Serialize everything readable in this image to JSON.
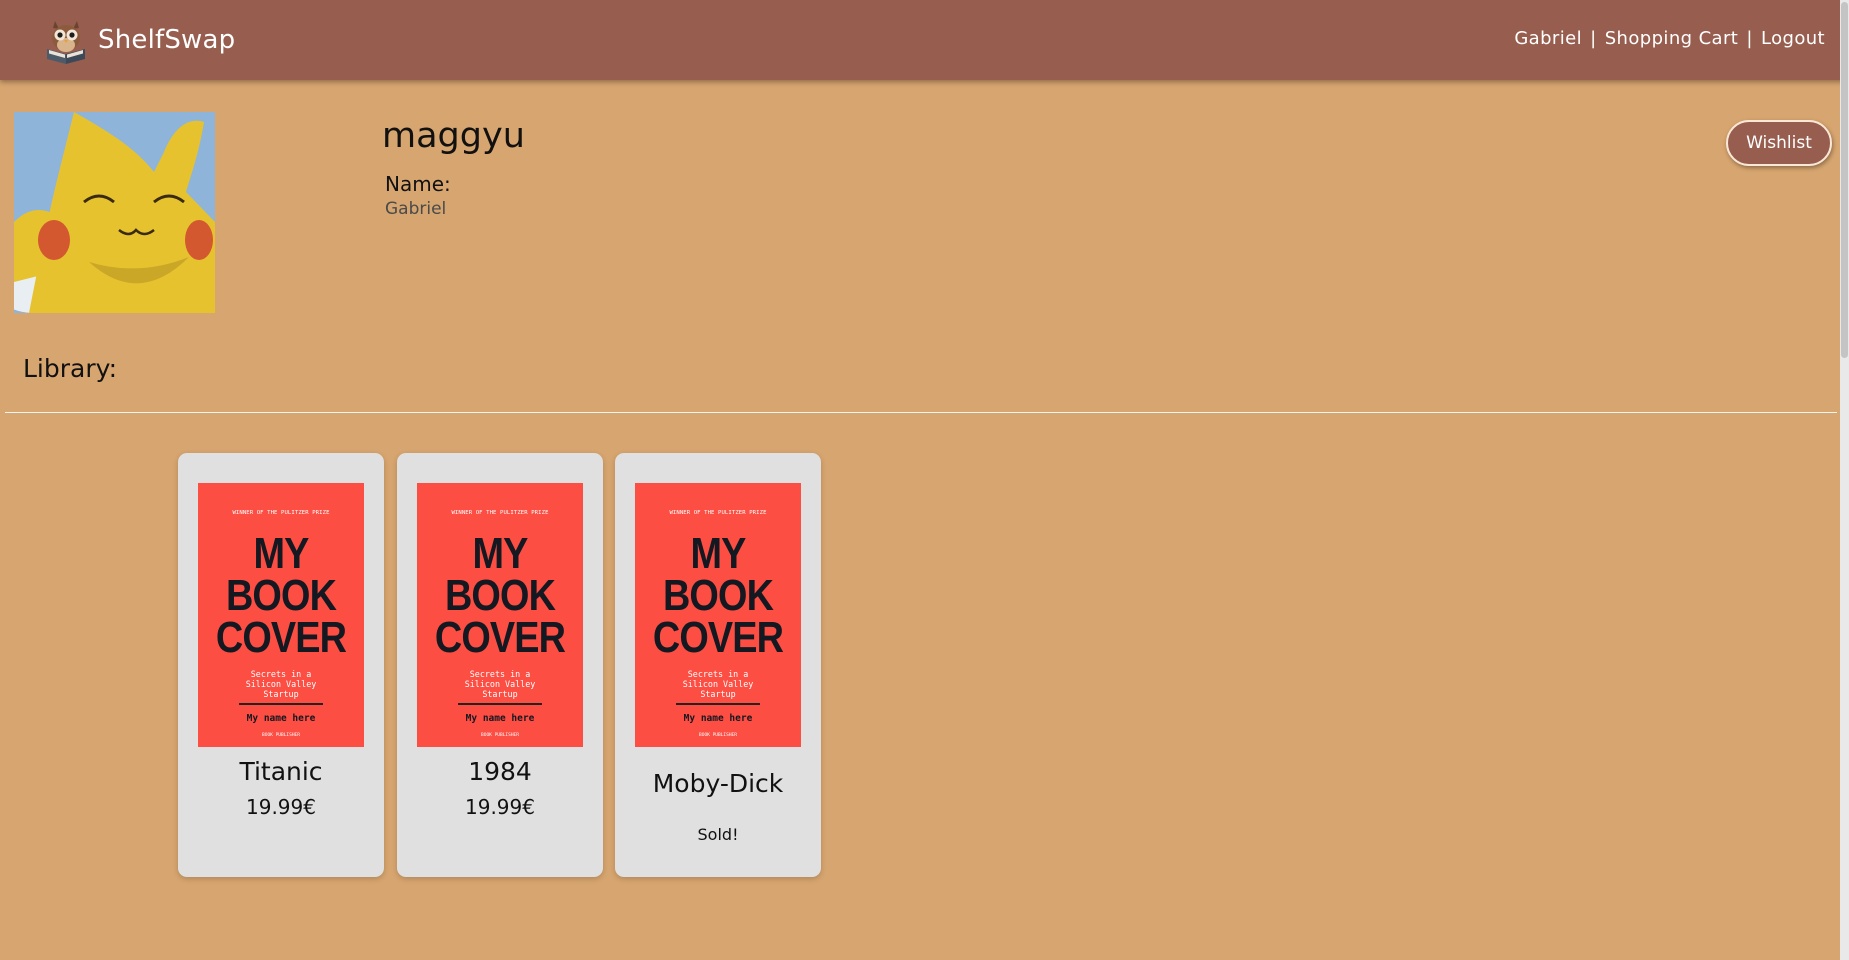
{
  "app": {
    "name": "ShelfSwap"
  },
  "nav": {
    "user": "Gabriel",
    "cart": "Shopping Cart",
    "logout": "Logout",
    "separator": "|"
  },
  "profile": {
    "username": "maggyu",
    "name_label": "Name:",
    "name_value": "Gabriel",
    "avatar_icon": "pikachu-avatar"
  },
  "wishlist_button": "Wishlist",
  "library": {
    "title": "Library:",
    "books": [
      {
        "title": "Titanic",
        "price": "19.99€",
        "status": "",
        "cover": {
          "award": "WINNER OF THE PULITZER PRIZE",
          "line1": "MY",
          "line2": "BOOK",
          "line3": "COVER",
          "subtitle": "Secrets in a\nSilicon Valley\nStartup",
          "author": "My name here",
          "publisher": "BOOK PUBLISHER"
        }
      },
      {
        "title": "1984",
        "price": "19.99€",
        "status": "",
        "cover": {
          "award": "WINNER OF THE PULITZER PRIZE",
          "line1": "MY",
          "line2": "BOOK",
          "line3": "COVER",
          "subtitle": "Secrets in a\nSilicon Valley\nStartup",
          "author": "My name here",
          "publisher": "BOOK PUBLISHER"
        }
      },
      {
        "title": "Moby-Dick",
        "price": "",
        "status": "Sold!",
        "cover": {
          "award": "WINNER OF THE PULITZER PRIZE",
          "line1": "MY",
          "line2": "BOOK",
          "line3": "COVER",
          "subtitle": "Secrets in a\nSilicon Valley\nStartup",
          "author": "My name here",
          "publisher": "BOOK PUBLISHER"
        }
      }
    ]
  },
  "colors": {
    "navbar": "#975e4f",
    "background": "#d7a56f",
    "card": "#e0e0e0",
    "cover": "#fd4e44"
  }
}
